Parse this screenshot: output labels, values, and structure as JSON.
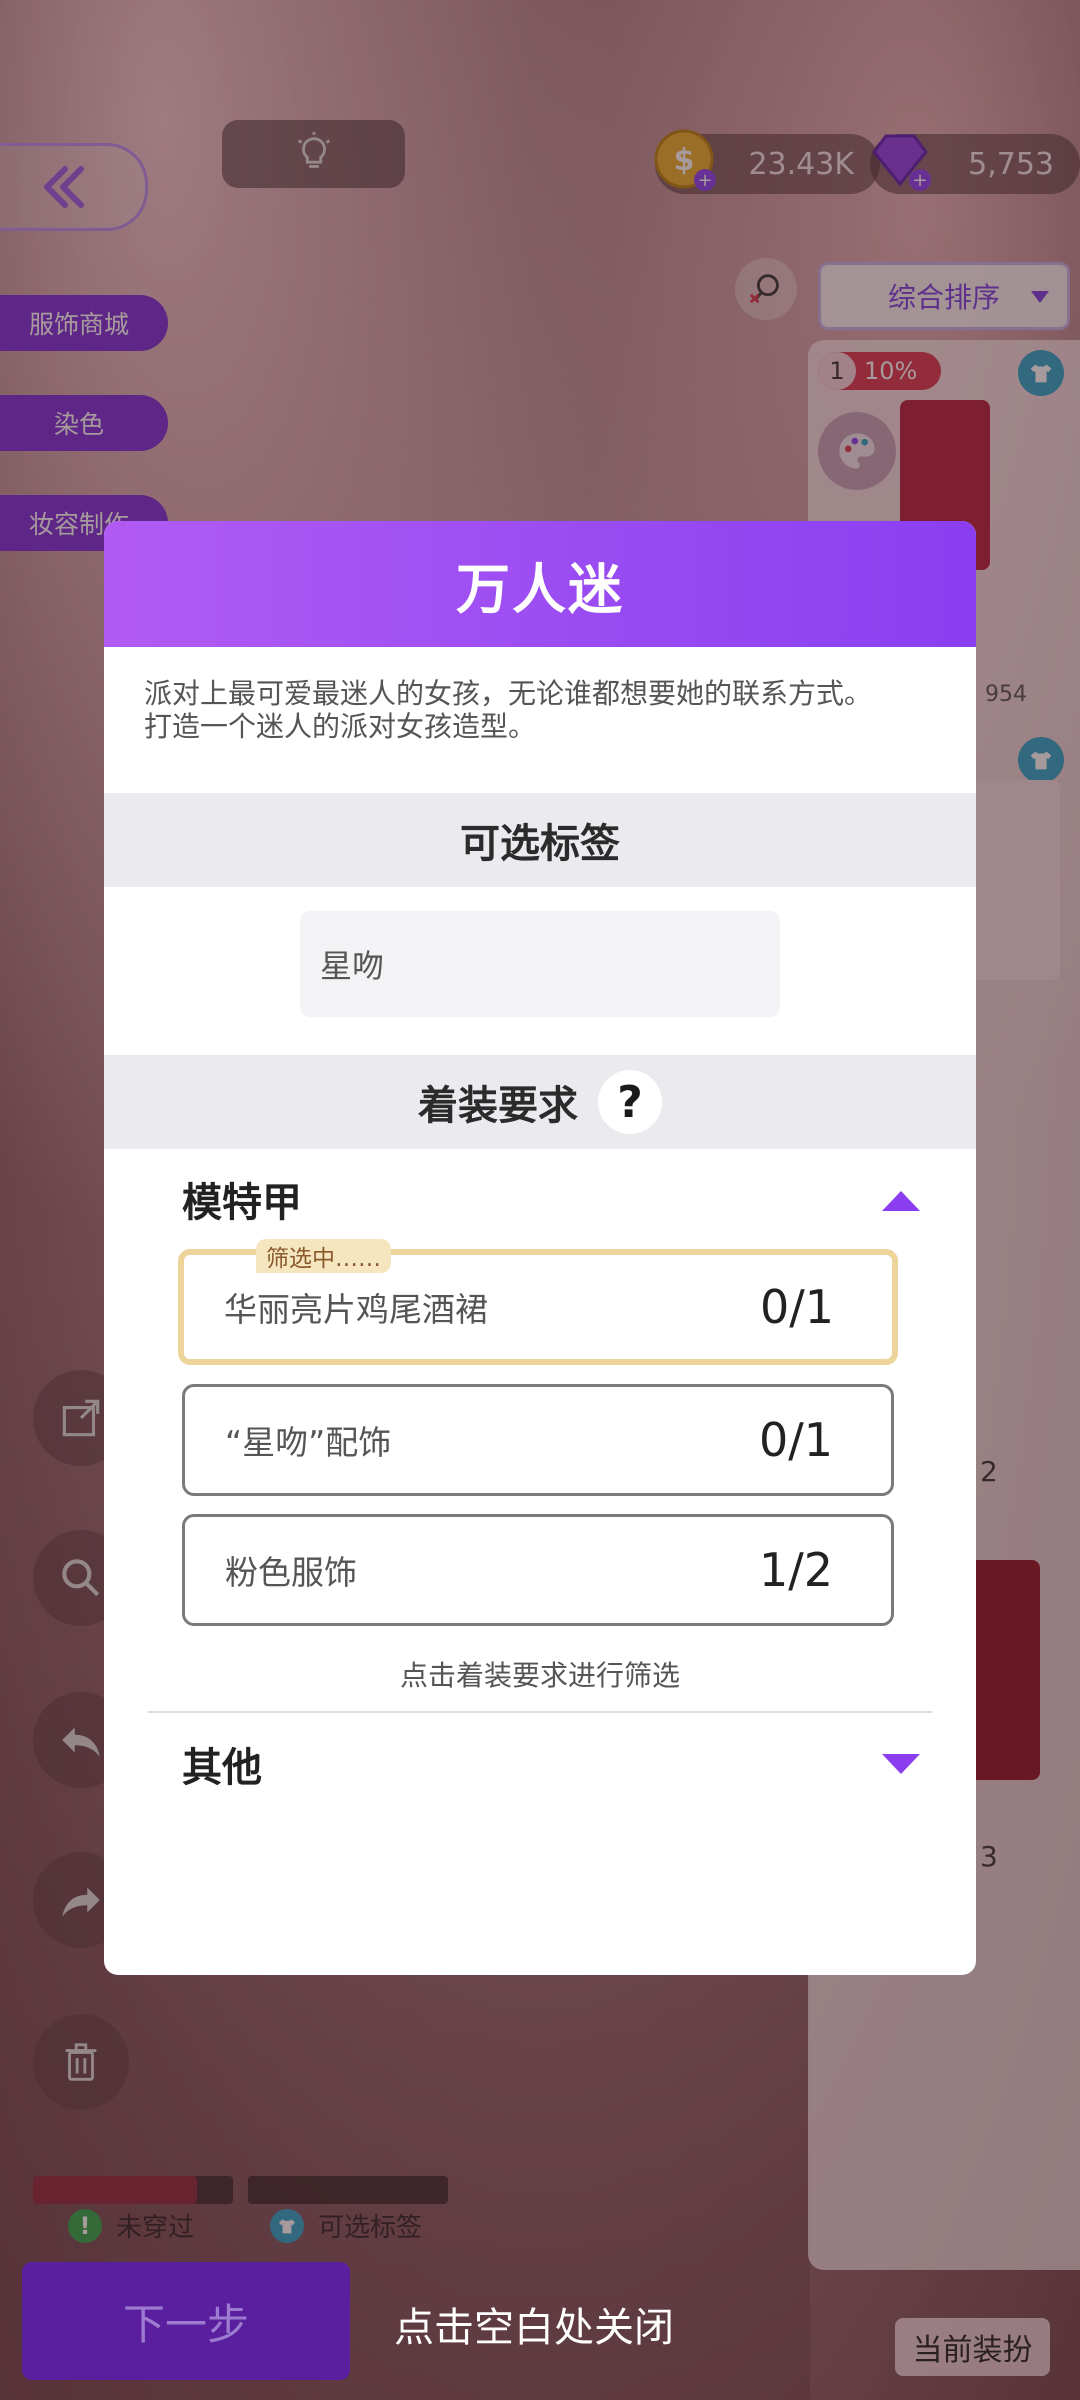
{
  "top_bar": {
    "gold": "23.43K",
    "gems": "5,753"
  },
  "side_menu": [
    "服饰商城",
    "染色",
    "妆容制作"
  ],
  "right_panel": {
    "sort_label": "综合排序",
    "rank_number": "1",
    "rank_percent": "10%",
    "score_partial_1": "954",
    "score_partial_2": "2",
    "score_partial_3": "3"
  },
  "legend": {
    "not_worn": "未穿过",
    "optional_tag": "可选标签"
  },
  "bottom": {
    "next_label": "下一步",
    "close_hint": "点击空白处关闭",
    "current_outfit": "当前装扮"
  },
  "modal": {
    "title": "万人迷",
    "description_line1": "派对上最可爱最迷人的女孩，无论谁都想要她的联系方式。",
    "description_line2": "打造一个迷人的派对女孩造型。",
    "tags_section_title": "可选标签",
    "tag_chip": "星吻",
    "requirements_section_title": "着装要求",
    "help_symbol": "?",
    "groups": [
      {
        "name": "模特甲",
        "expanded": true,
        "filtering_badge": "筛选中……",
        "requirements": [
          {
            "label": "华丽亮片鸡尾酒裙",
            "count": "0/1",
            "selected": true
          },
          {
            "label": "“星吻”配饰",
            "count": "0/1",
            "selected": false
          },
          {
            "label": "粉色服饰",
            "count": "1/2",
            "selected": false
          }
        ],
        "note": "点击着装要求进行筛选"
      },
      {
        "name": "其他",
        "expanded": false
      }
    ]
  },
  "colors": {
    "accent_purple": "#8a3ef0",
    "side_button": "#7a2ed9",
    "selected_border": "#ecd49a",
    "rank_badge": "#d9374d",
    "tshirt_badge": "#2ba6c9"
  }
}
